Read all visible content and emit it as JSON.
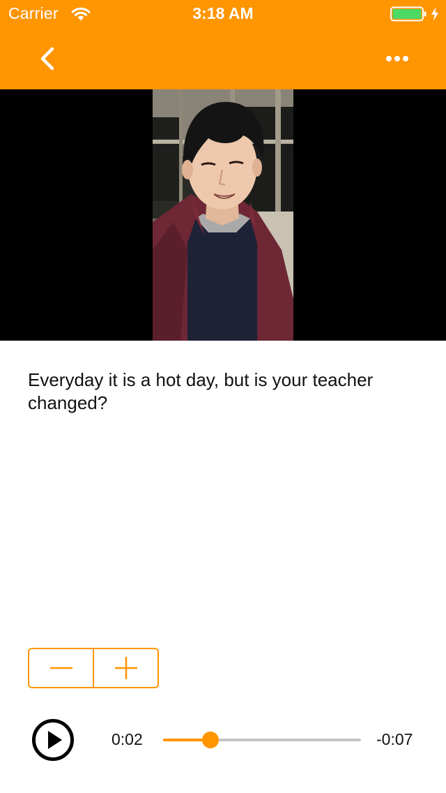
{
  "status_bar": {
    "carrier": "Carrier",
    "time": "3:18 AM",
    "battery_level": 1.0
  },
  "nav": {
    "back_icon": "chevron-left-icon",
    "more_icon": "ellipsis-icon"
  },
  "colors": {
    "accent": "#ff9500",
    "video_background": "#000000",
    "battery_fill": "#4cd964"
  },
  "caption": {
    "text": "Everyday it is a hot day, but is your teacher changed?"
  },
  "stepper": {
    "decrement_icon": "minus-icon",
    "increment_icon": "plus-icon"
  },
  "player": {
    "play_icon": "play-icon",
    "elapsed": "0:02",
    "remaining": "-0:07",
    "progress": 0.24
  }
}
